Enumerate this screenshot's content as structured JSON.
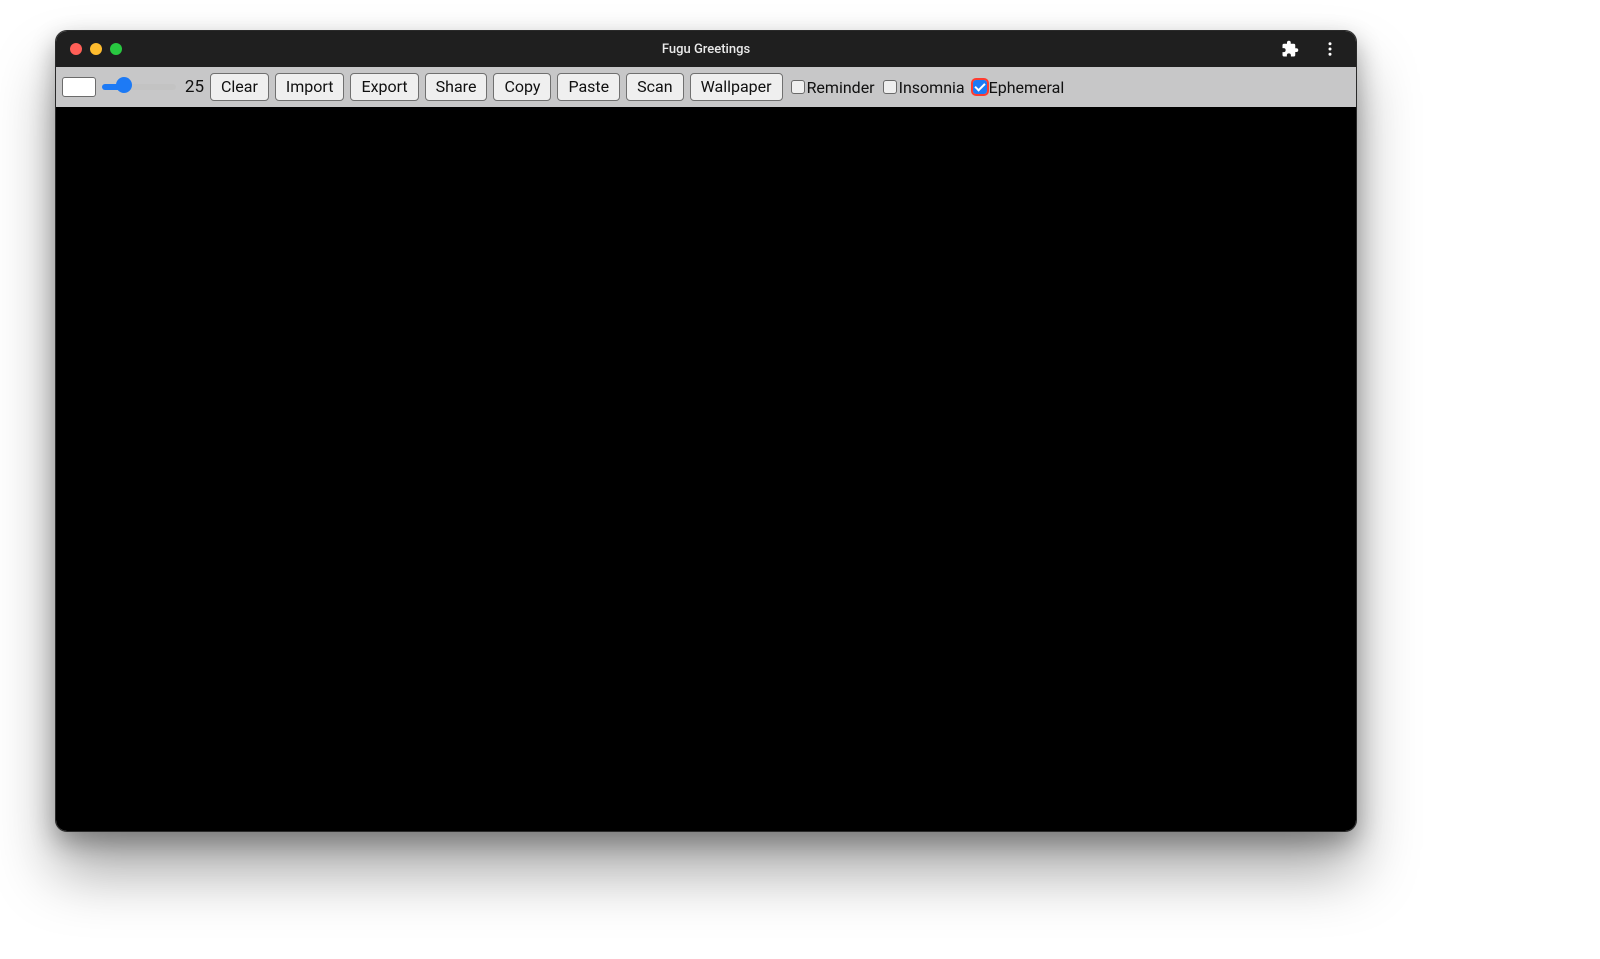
{
  "window": {
    "title": "Fugu Greetings"
  },
  "titlebar": {
    "icons": {
      "extensions": "extensions-icon",
      "menu": "kebab-menu-icon"
    }
  },
  "toolbar": {
    "color_swatch": "#ffffff",
    "brush_size": 25,
    "brush_size_display": "25",
    "brush_min": 1,
    "brush_max": 100,
    "buttons": {
      "clear": "Clear",
      "import": "Import",
      "export": "Export",
      "share": "Share",
      "copy": "Copy",
      "paste": "Paste",
      "scan": "Scan",
      "wallpaper": "Wallpaper"
    },
    "checkboxes": {
      "reminder": {
        "label": "Reminder",
        "checked": false
      },
      "insomnia": {
        "label": "Insomnia",
        "checked": false
      },
      "ephemeral": {
        "label": "Ephemeral",
        "checked": true
      }
    }
  },
  "colors": {
    "accent": "#1d7af5",
    "titlebar_bg": "#1f1f1f",
    "toolbar_bg": "#c7c7c8",
    "canvas_bg": "#000000"
  }
}
